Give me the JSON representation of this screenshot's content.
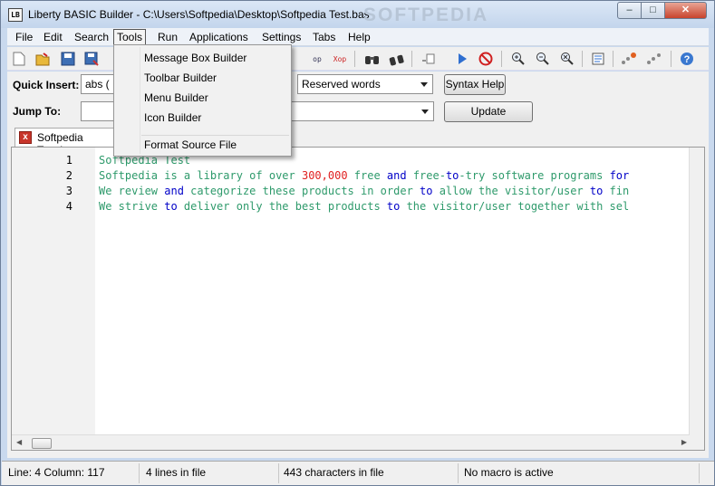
{
  "window": {
    "app_icon": "LB",
    "title": "Liberty BASIC Builder - C:\\Users\\Softpedia\\Desktop\\Softpedia Test.bas",
    "watermark": "SOFTPEDIA"
  },
  "caption_buttons": {
    "minimize": "–",
    "maximize": "□",
    "close": "✕"
  },
  "menubar": {
    "items": [
      "File",
      "Edit",
      "Search",
      "Tools",
      "Run",
      "Applications",
      "Settings",
      "Tabs",
      "Help"
    ],
    "active": "Tools"
  },
  "toolbar": {
    "icons": [
      "new-file-icon",
      "open-file-icon",
      "save-icon",
      "save-as-icon",
      "cut-icon",
      "copy-icon",
      "paste-icon",
      "undo-icon",
      "redo-icon",
      "find-icon",
      "find-next-icon",
      "goto-line-icon",
      "run-icon",
      "kill-run-icon",
      "zoom-in-icon",
      "zoom-out-icon",
      "zoom-reset-icon",
      "properties-icon",
      "record-macro-icon",
      "play-macro-icon",
      "help-icon"
    ]
  },
  "quick_insert": {
    "label": "Quick Insert:",
    "value": "abs (",
    "category": "Reserved words",
    "syntax_help": "Syntax Help"
  },
  "jump_to": {
    "label": "Jump To:",
    "value": "",
    "update": "Update"
  },
  "tab": {
    "label": "Softpedia Test.bas",
    "close": "x"
  },
  "editor": {
    "line_numbers": [
      "1",
      "2",
      "3",
      "4"
    ],
    "lines": [
      [
        {
          "t": "Softpedia Test",
          "c": "text"
        }
      ],
      [
        {
          "t": "Softpedia is a library of over ",
          "c": "text"
        },
        {
          "t": "300,000",
          "c": "num"
        },
        {
          "t": " free ",
          "c": "text"
        },
        {
          "t": "and",
          "c": "kw"
        },
        {
          "t": " free-",
          "c": "text"
        },
        {
          "t": "to",
          "c": "kw"
        },
        {
          "t": "-try software programs ",
          "c": "text"
        },
        {
          "t": "for",
          "c": "kw"
        }
      ],
      [
        {
          "t": "We review ",
          "c": "text"
        },
        {
          "t": "and",
          "c": "kw"
        },
        {
          "t": " categorize these products in order ",
          "c": "text"
        },
        {
          "t": "to",
          "c": "kw"
        },
        {
          "t": " allow the visitor/user ",
          "c": "text"
        },
        {
          "t": "to",
          "c": "kw"
        },
        {
          "t": " fin",
          "c": "text"
        }
      ],
      [
        {
          "t": "We strive ",
          "c": "text"
        },
        {
          "t": "to",
          "c": "kw"
        },
        {
          "t": " deliver only the best products ",
          "c": "text"
        },
        {
          "t": "to",
          "c": "kw"
        },
        {
          "t": " the visitor/user together with sel",
          "c": "text"
        }
      ]
    ]
  },
  "status": {
    "position": "Line: 4 Column: 117",
    "lines": "4 lines in file",
    "chars": "443 characters in file",
    "macro": "No macro is active"
  },
  "tools_menu": {
    "items": [
      "Message Box Builder",
      "Toolbar Builder",
      "Menu Builder",
      "Icon Builder"
    ],
    "after_separator": [
      "Format Source File"
    ]
  },
  "colors": {
    "text": "#2e9a6b",
    "keyword": "#0000c8",
    "number": "#e02020"
  }
}
